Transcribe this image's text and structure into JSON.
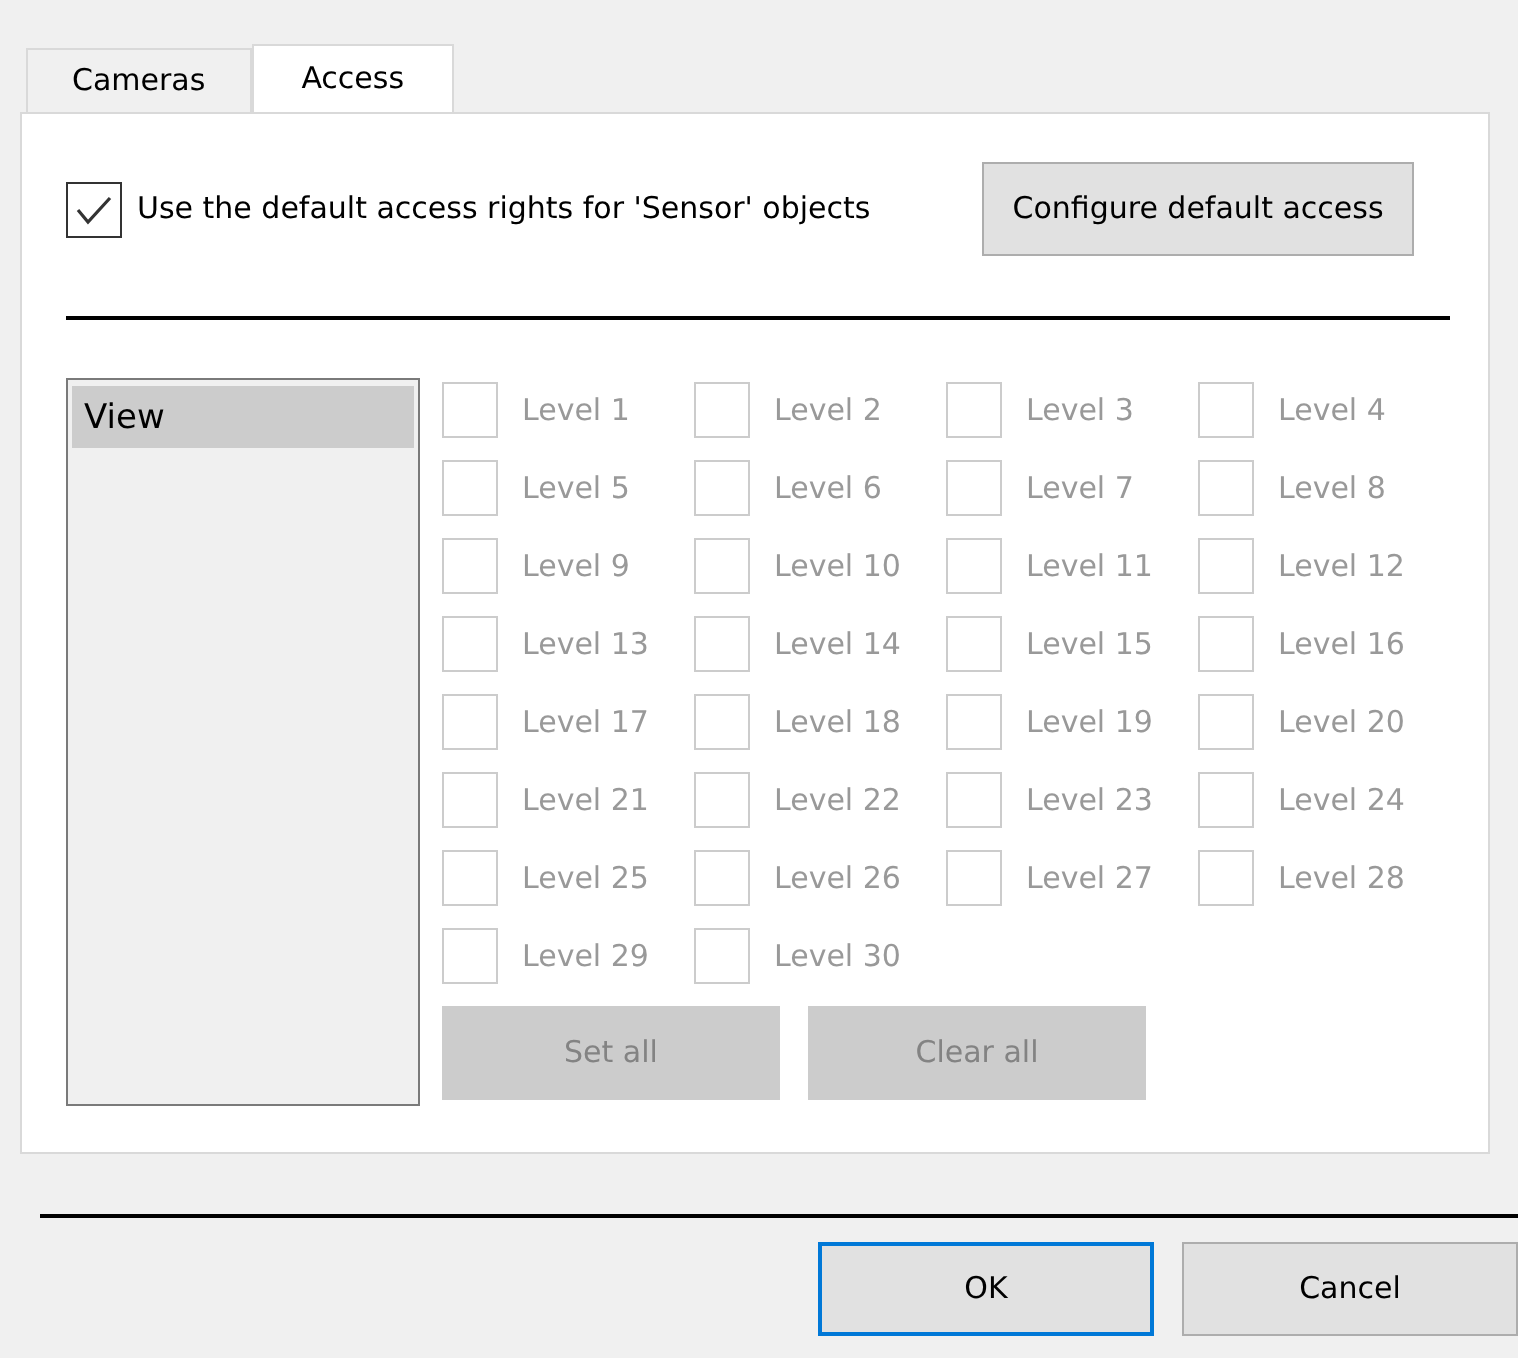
{
  "tabs": [
    {
      "label": "Cameras",
      "selected": false
    },
    {
      "label": "Access",
      "selected": true
    }
  ],
  "default_access": {
    "label": "Use the default access rights for 'Sensor' objects",
    "checked": true
  },
  "configure_button": {
    "label": "Configure default access",
    "disabled": false
  },
  "rights_list": [
    {
      "label": "View",
      "selected": true
    }
  ],
  "levels": [
    {
      "label": "Level 1",
      "checked": false,
      "disabled": true
    },
    {
      "label": "Level 2",
      "checked": false,
      "disabled": true
    },
    {
      "label": "Level 3",
      "checked": false,
      "disabled": true
    },
    {
      "label": "Level 4",
      "checked": false,
      "disabled": true
    },
    {
      "label": "Level 5",
      "checked": false,
      "disabled": true
    },
    {
      "label": "Level 6",
      "checked": false,
      "disabled": true
    },
    {
      "label": "Level 7",
      "checked": false,
      "disabled": true
    },
    {
      "label": "Level 8",
      "checked": false,
      "disabled": true
    },
    {
      "label": "Level 9",
      "checked": false,
      "disabled": true
    },
    {
      "label": "Level 10",
      "checked": false,
      "disabled": true
    },
    {
      "label": "Level 11",
      "checked": false,
      "disabled": true
    },
    {
      "label": "Level 12",
      "checked": false,
      "disabled": true
    },
    {
      "label": "Level 13",
      "checked": false,
      "disabled": true
    },
    {
      "label": "Level 14",
      "checked": false,
      "disabled": true
    },
    {
      "label": "Level 15",
      "checked": false,
      "disabled": true
    },
    {
      "label": "Level 16",
      "checked": false,
      "disabled": true
    },
    {
      "label": "Level 17",
      "checked": false,
      "disabled": true
    },
    {
      "label": "Level 18",
      "checked": false,
      "disabled": true
    },
    {
      "label": "Level 19",
      "checked": false,
      "disabled": true
    },
    {
      "label": "Level 20",
      "checked": false,
      "disabled": true
    },
    {
      "label": "Level 21",
      "checked": false,
      "disabled": true
    },
    {
      "label": "Level 22",
      "checked": false,
      "disabled": true
    },
    {
      "label": "Level 23",
      "checked": false,
      "disabled": true
    },
    {
      "label": "Level 24",
      "checked": false,
      "disabled": true
    },
    {
      "label": "Level 25",
      "checked": false,
      "disabled": true
    },
    {
      "label": "Level 26",
      "checked": false,
      "disabled": true
    },
    {
      "label": "Level 27",
      "checked": false,
      "disabled": true
    },
    {
      "label": "Level 28",
      "checked": false,
      "disabled": true
    },
    {
      "label": "Level 29",
      "checked": false,
      "disabled": true
    },
    {
      "label": "Level 30",
      "checked": false,
      "disabled": true
    }
  ],
  "level_buttons": [
    {
      "label": "Set all",
      "disabled": true
    },
    {
      "label": "Clear all",
      "disabled": true
    }
  ],
  "dialog_buttons": [
    {
      "label": "OK",
      "default": true
    },
    {
      "label": "Cancel",
      "default": false
    }
  ]
}
